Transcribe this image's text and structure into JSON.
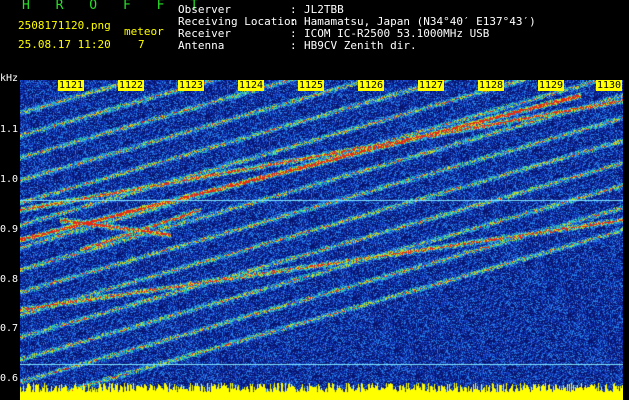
{
  "header": {
    "brand": "HROFFT",
    "filename": "2508171120.png",
    "datetime": "25.08.17 11:20",
    "meteor_label": "meteor",
    "meteor_count": "7",
    "info": [
      {
        "key": "Observer",
        "value": "JL2TBB"
      },
      {
        "key": "Receiving Location",
        "value": "Hamamatsu, Japan (N34°40′ E137°43′)"
      },
      {
        "key": "Receiver",
        "value": "ICOM IC-R2500 53.1000MHz USB"
      },
      {
        "key": "Antenna",
        "value": "HB9CV Zenith dir."
      }
    ]
  },
  "spectrogram": {
    "y_unit": "kHz",
    "y_ticks": [
      "1.1",
      "1.0",
      "0.9",
      "0.8",
      "0.7",
      "0.6"
    ],
    "x_ticks": [
      "1121",
      "1122",
      "1123",
      "1124",
      "1125",
      "1126",
      "1127",
      "1128",
      "1129",
      "1130"
    ],
    "reference_line_khz": 0.96,
    "colors": {
      "background": "#0a1a7a",
      "noise": "#2a6ad8",
      "signal": "#e02010",
      "baseline": "#ffff00",
      "marker": "#7fe7ff"
    }
  }
}
